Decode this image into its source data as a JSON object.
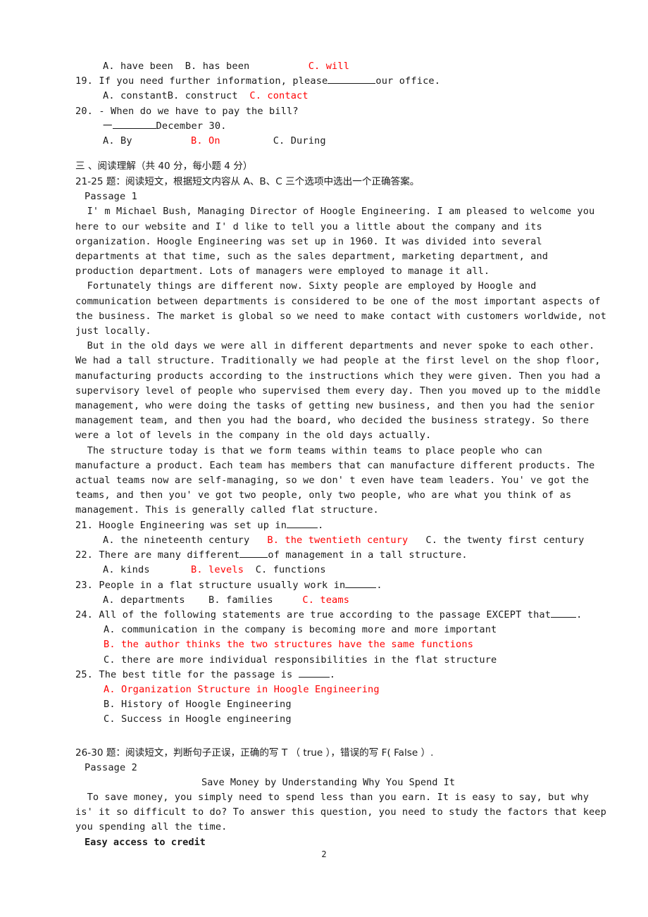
{
  "document": {
    "page_number": "2",
    "accent_red": "#ff0000"
  },
  "question_18_options": {
    "a": "A. have been",
    "b": "B. has been",
    "c": "C. will"
  },
  "question_19": {
    "number": "19.",
    "stem_before": "If you need further information, please",
    "stem_after": "our office.",
    "a": "A. constant",
    "b": "B. construct",
    "c": "C. contact"
  },
  "question_20": {
    "number": "20.",
    "line1": "- When do we have to pay the bill?",
    "dash": "一",
    "line2_after": "December 30.",
    "a": "A. By",
    "b": "B. On",
    "c": "C. During"
  },
  "section_three": {
    "heading": "三 、阅读理解（共 40 分，每小题 4 分）",
    "instruction": "21-25 题：阅读短文，根据短文内容从 A、B、C 三个选项中选出一个正确答案。",
    "passage_label": "Passage 1"
  },
  "passage1": {
    "paragraph1": [
      "  I' m Michael Bush, Managing Director of Hoogle Engineering. I am pleased to welcome you",
      "here to our website and I' d like to tell you a little about the company and its",
      "organization. Hoogle Engineering was set up in 1960. It was divided into several",
      "departments at that time, such as the sales department, marketing department, and",
      "production department. Lots of managers were employed to manage it all."
    ],
    "paragraph2": [
      "  Fortunately things are different now. Sixty people are employed by Hoogle and",
      "communication between departments is considered to be one of the most important aspects of",
      "the business. The market is global so we need to make contact with customers worldwide, not",
      "just locally."
    ],
    "paragraph3": [
      "  But in the old days we were all in different departments and never spoke to each other.",
      "We had a tall structure. Traditionally we had people at the first level on the shop floor,",
      "manufacturing products according to the instructions which they were given. Then you had a",
      "supervisory level of people who supervised them every day. Then you moved up to the middle",
      "management, who were doing the tasks of getting new business, and then you had the senior",
      "management team, and then you had the board, who decided the business strategy. So there",
      "were a lot of levels in the company in the old days actually."
    ],
    "paragraph4": [
      "  The structure today is that we form teams within teams to place people who can",
      "manufacture a product. Each team has members that can manufacture different products. The",
      "actual teams now are self-managing, so we don' t even have team leaders. You' ve got the",
      "teams, and then you' ve got two people, only two people, who are what you think of as",
      "management. This is generally called flat structure."
    ]
  },
  "question_21": {
    "number": "21.",
    "stem_before": "Hoogle Engineering was set up in",
    "stem_after": ".",
    "a": "A. the nineteenth century",
    "b": "B. the twentieth century",
    "c": "C. the twenty first century"
  },
  "question_22": {
    "number": "22.",
    "stem_before": "There are many different",
    "stem_after": "of management in a tall structure.",
    "a": "A. kinds",
    "b": "B. levels",
    "c": "C. functions"
  },
  "question_23": {
    "number": "23.",
    "stem_before": "People in a flat structure usually work in",
    "stem_after": ".",
    "a": "A. departments",
    "b": "B. families",
    "c": "C. teams"
  },
  "question_24": {
    "number": "24.",
    "stem_before": "All of the following statements are true according to the passage EXCEPT that",
    "stem_after": ".",
    "a": "A. communication in the company is becoming more and more important",
    "b": "B. the author thinks the two structures have the same functions",
    "c": "C. there are more individual responsibilities in the flat structure"
  },
  "question_25": {
    "number": "25.",
    "stem_before": "The best title for the passage is ",
    "stem_after": ".",
    "a": "A. Organization Structure in Hoogle Engineering",
    "b": "B. History of Hoogle Engineering",
    "c": "C. Success in Hoogle engineering"
  },
  "section_26_30": {
    "instruction": "26-30 题：阅读短文，判断句子正误，正确的写 T （ true ），错误的写 F( False ）.",
    "passage_label": "Passage 2",
    "title": "Save Money by Understanding Why You Spend It",
    "paragraph1": [
      "  To save money, you simply need to spend less than you earn. It is easy to say, but why",
      "is' it so difficult to do? To answer this question, you need to study the factors that keep",
      "you spending all the time."
    ],
    "subheading": "Easy access to credit"
  }
}
